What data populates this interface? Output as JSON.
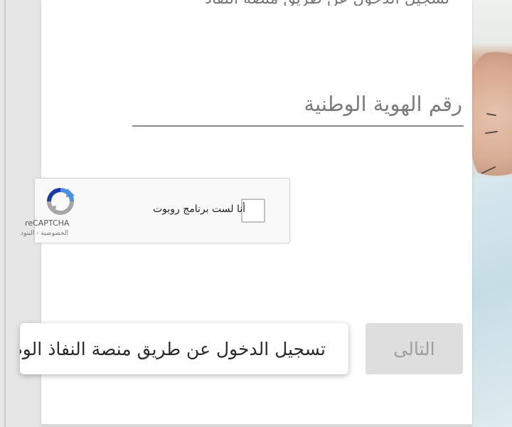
{
  "page": {
    "top_text_fragment": "تسجيل الدخول عن طريق منصة النفاذ الوطني الموحد"
  },
  "form": {
    "national_id": {
      "placeholder": "رقم الهوية الوطنية",
      "value": ""
    },
    "recaptcha": {
      "label": "أنا لست برنامج روبوت",
      "brand": "reCAPTCHA",
      "links": "الخصوصية - البنود"
    },
    "buttons": {
      "next_label": "التالى",
      "nafath_label": "تسجيل الدخول عن طريق منصة النفاذ الوطني الموحد"
    }
  },
  "colors": {
    "card_bg": "#ffffff",
    "field_underline": "#8a8a8a",
    "next_button_bg": "#dedede",
    "next_button_text": "#9c9c9c",
    "recaptcha_blue": "#4a90e2"
  },
  "icons": {
    "recaptcha_logo": "recaptcha-logo-icon"
  }
}
